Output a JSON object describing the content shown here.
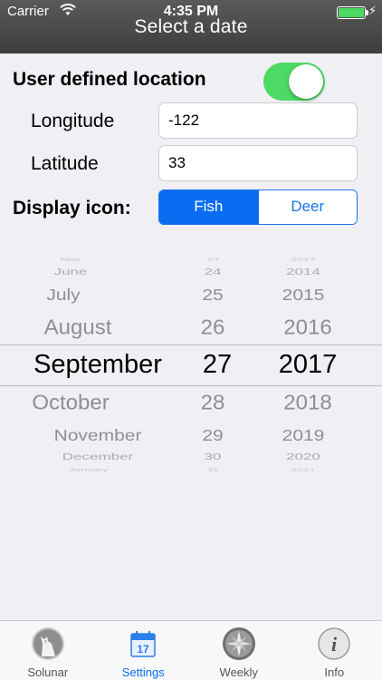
{
  "status_bar": {
    "carrier": "Carrier",
    "time": "4:35 PM"
  },
  "nav": {
    "title": "Select a date"
  },
  "settings": {
    "user_location_label": "User defined location",
    "user_location_enabled": true,
    "longitude_label": "Longitude",
    "longitude_value": "-122",
    "latitude_label": "Latitude",
    "latitude_value": "33",
    "display_icon_label": "Display icon:",
    "display_icon_options": [
      "Fish",
      "Deer"
    ],
    "display_icon_selected": "Fish"
  },
  "date_picker": {
    "months": [
      "May",
      "June",
      "July",
      "August",
      "September",
      "October",
      "November",
      "December",
      "January"
    ],
    "days": [
      "23",
      "24",
      "25",
      "26",
      "27",
      "28",
      "29",
      "30",
      "31"
    ],
    "years": [
      "2013",
      "2014",
      "2015",
      "2016",
      "2017",
      "2018",
      "2019",
      "2020",
      "2021"
    ],
    "selected": {
      "month": "September",
      "day": "27",
      "year": "2017"
    }
  },
  "tabbar": {
    "tabs": [
      {
        "label": "Solunar",
        "icon": "wolf-moon-icon"
      },
      {
        "label": "Settings",
        "icon": "calendar-icon"
      },
      {
        "label": "Weekly",
        "icon": "compass-icon"
      },
      {
        "label": "Info",
        "icon": "info-icon"
      }
    ],
    "active": "Settings"
  },
  "colors": {
    "accent": "#0a6cf0",
    "toggle_on": "#4cd964",
    "header": "#444444"
  }
}
